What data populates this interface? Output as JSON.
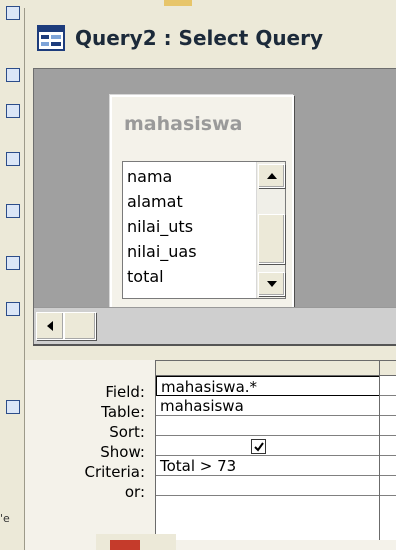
{
  "window": {
    "title": "Query2 : Select Query",
    "icon": "query-icon"
  },
  "table_box": {
    "name": "mahasiswa",
    "fields": [
      "nama",
      "alamat",
      "nilai_uts",
      "nilai_uas",
      "total"
    ]
  },
  "grid": {
    "row_labels": [
      "Field:",
      "Table:",
      "Sort:",
      "Show:",
      "Criteria:",
      "or:"
    ],
    "column1": {
      "field": "mahasiswa.*",
      "table": "mahasiswa",
      "sort": "",
      "show": true,
      "criteria": "Total > 73",
      "or": ""
    }
  },
  "background": {
    "strip_text": "'e"
  },
  "icons": {
    "scroll_up": "arrow-up-icon",
    "scroll_down": "arrow-down-icon",
    "scroll_left": "arrow-left-icon",
    "checkbox_checked": "checkmark-icon"
  }
}
